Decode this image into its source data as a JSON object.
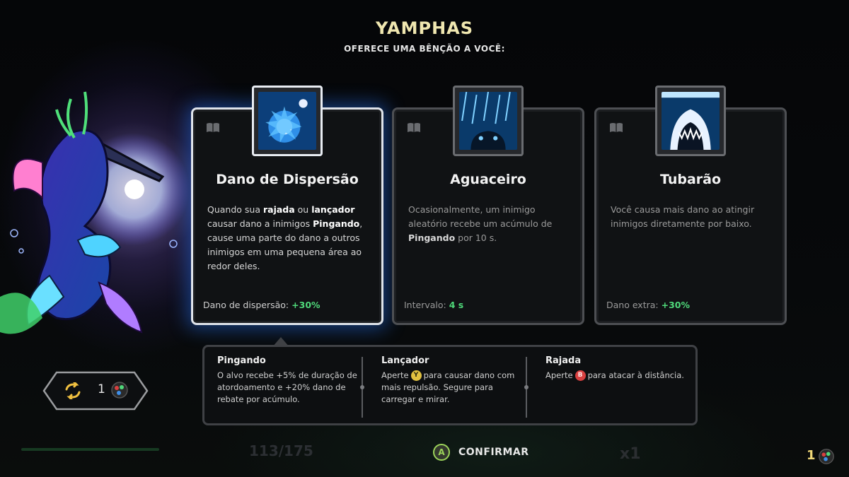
{
  "header": {
    "god_name": "YAMPHAS",
    "subtitle": "OFERECE UMA BÊNÇÃO A VOCÊ:"
  },
  "cards": [
    {
      "title": "Dano de Dispersão",
      "icon": "scatter-burst-icon",
      "selected": true,
      "desc_parts": [
        "Quando sua ",
        "rajada",
        " ou ",
        "lançador",
        " causar dano a inimigos ",
        "Pingando",
        ", cause uma parte do dano a outros inimigos em uma pequena área ao redor deles."
      ],
      "stat_label": "Dano de dispersão:",
      "stat_value": "+30%"
    },
    {
      "title": "Aguaceiro",
      "icon": "rain-downpour-icon",
      "selected": false,
      "desc_parts": [
        "Ocasionalmente, um inimigo aleatório recebe um acúmulo de ",
        "Pingando",
        " por 10 s."
      ],
      "stat_label": "Intervalo:",
      "stat_value": "4 s"
    },
    {
      "title": "Tubarão",
      "icon": "shark-jaws-icon",
      "selected": false,
      "desc_parts": [
        "Você causa mais dano ao atingir inimigos diretamente por baixo."
      ],
      "stat_label": "Dano extra:",
      "stat_value": "+30%"
    }
  ],
  "tooltip": {
    "pingando": {
      "title": "Pingando",
      "text": "O alvo recebe +5% de duração de atordoamento e +20% dano de rebate por acúmulo."
    },
    "lancador": {
      "title": "Lançador",
      "pre": "Aperte",
      "button": "Y",
      "post": "para causar dano com mais repulsão. Segure para carregar e mirar."
    },
    "rajada": {
      "title": "Rajada",
      "pre": "Aperte",
      "button": "B",
      "post": "para atacar à distância."
    }
  },
  "reroll": {
    "count": "1"
  },
  "footer": {
    "confirm_button": "A",
    "confirm_label": "CONFIRMAR",
    "hp": "113/175",
    "multiplier": "x1",
    "corner_count": "1"
  },
  "colors": {
    "title_gold": "#f0e7b0",
    "stat_green": "#4fd97a",
    "y_button": "#e0c040",
    "b_button": "#d84040",
    "a_button": "#9cd35a"
  }
}
